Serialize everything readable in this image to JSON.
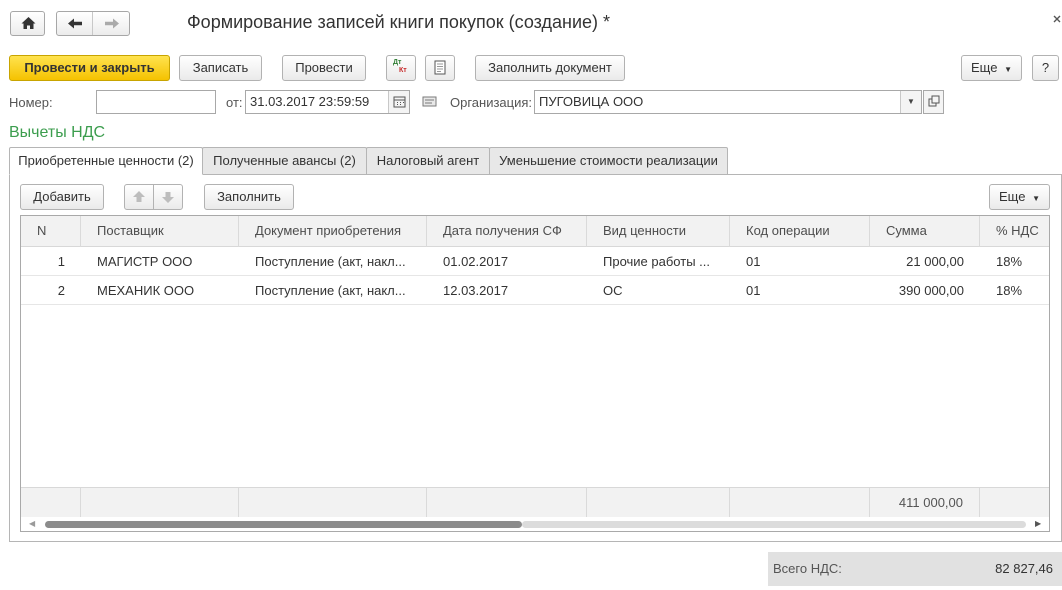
{
  "window": {
    "title": "Формирование записей книги покупок (создание) *"
  },
  "toolbar": {
    "post_close": "Провести и закрыть",
    "save": "Записать",
    "post": "Провести",
    "dtkt_top": "Дт",
    "dtkt_bottom": "Кт",
    "fill_document": "Заполнить документ",
    "more": "Еще",
    "help": "?"
  },
  "form": {
    "number_label": "Номер:",
    "number_value": "",
    "date_label": "от:",
    "date_value": "31.03.2017 23:59:59",
    "org_label": "Организация:",
    "org_value": "ПУГОВИЦА ООО"
  },
  "section_title": "Вычеты НДС",
  "tabs": [
    {
      "label": "Приобретенные ценности (2)",
      "active": true
    },
    {
      "label": "Полученные авансы (2)",
      "active": false
    },
    {
      "label": "Налоговый агент",
      "active": false
    },
    {
      "label": "Уменьшение стоимости реализации",
      "active": false
    }
  ],
  "table_toolbar": {
    "add": "Добавить",
    "fill": "Заполнить",
    "more": "Еще"
  },
  "table": {
    "columns": [
      "N",
      "Поставщик",
      "Документ приобретения",
      "Дата получения СФ",
      "Вид ценности",
      "Код операции",
      "Сумма",
      "% НДС"
    ],
    "rows": [
      {
        "n": "1",
        "supplier": "МАГИСТР ООО",
        "document": "Поступление (акт, накл...",
        "date": "01.02.2017",
        "kind": "Прочие работы ...",
        "code": "01",
        "sum": "21 000,00",
        "vat": "18%"
      },
      {
        "n": "2",
        "supplier": "МЕХАНИК ООО",
        "document": "Поступление (акт, накл...",
        "date": "12.03.2017",
        "kind": "ОС",
        "code": "01",
        "sum": "390 000,00",
        "vat": "18%"
      }
    ],
    "footer_sum": "411 000,00"
  },
  "totals": {
    "vat_label": "Всего НДС:",
    "vat_value": "82 827,46"
  }
}
